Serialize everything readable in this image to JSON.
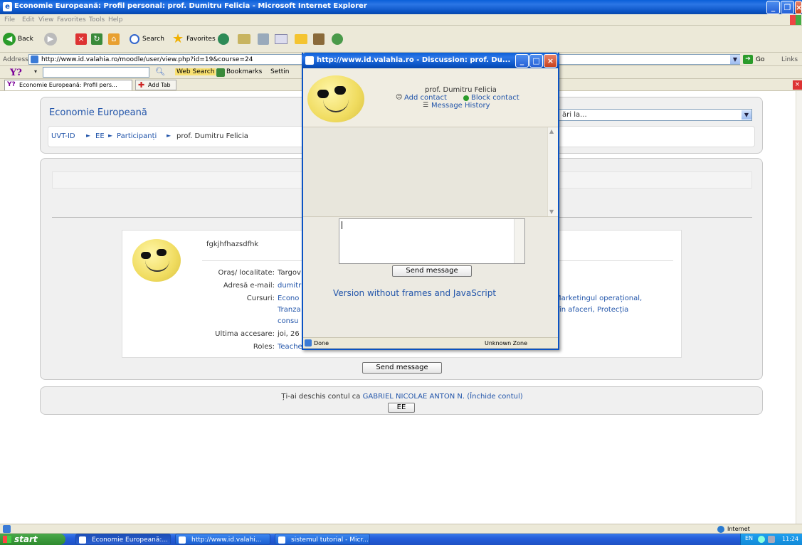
{
  "browser": {
    "title": "Economie Europeană: Profil personal: prof. Dumitru Felicia - Microsoft Internet Explorer",
    "menu": [
      "File",
      "Edit",
      "View",
      "Favorites",
      "Tools",
      "Help"
    ],
    "back_label": "Back",
    "search_label": "Search",
    "favorites_label": "Favorites",
    "address_label": "Address",
    "address_value": "http://www.id.valahia.ro/moodle/user/view.php?id=19&course=24",
    "go_label": "Go",
    "links_label": "Links",
    "yahoo_web_search": "Web Search",
    "yahoo_bookmarks": "Bookmarks",
    "yahoo_settings": "Settin",
    "tab_label": "Economie Europeană: Profil pers...",
    "add_tab_label": "Add Tab",
    "status_zone": "Internet"
  },
  "page": {
    "course_title": "Economie Europeană",
    "jump_select": "ări la...",
    "breadcrumb": [
      "UVT-ID",
      "EE",
      "Participanți",
      "prof. Dumitru Felicia"
    ],
    "breadcrumb_sep": "►",
    "profile": {
      "description": "fgkjhfhazsdfhk",
      "fields": [
        {
          "label": "Oraș/ localitate:",
          "value": "Targov"
        },
        {
          "label": "Adresă e-mail:",
          "value": "dumitr"
        },
        {
          "label": "Cursuri:",
          "value": "Econo"
        },
        {
          "label": "Ultima accesare:",
          "value": "joi, 26"
        },
        {
          "label": "Roles:",
          "value": "Teache"
        }
      ],
      "courses_line2": "Tranza",
      "courses_line3": "consu",
      "courses_right1": "Marketingul operațional,",
      "courses_right2": "în afaceri, Protecția"
    },
    "send_message_button": "Send message",
    "footer_text": "Ți-ai deschis contul ca",
    "footer_user": "GABRIEL NICOLAE ANTON N.",
    "footer_logout": "(Închide contul)",
    "footer_button": "EE"
  },
  "popup": {
    "title": "http://www.id.valahia.ro - Discussion: prof. Du...",
    "user_name": "prof. Dumitru Felicia",
    "add_contact": "Add contact",
    "block_contact": "Block contact",
    "message_history": "Message History",
    "send_button": "Send message",
    "no_frames_link": "Version without frames and JavaScript",
    "status_done": "Done",
    "status_zone": "Unknown Zone"
  },
  "taskbar": {
    "start_label": "start",
    "tasks": [
      "Economie Europeană:...",
      "http://www.id.valahi...",
      "sistemul tutorial - Micr..."
    ],
    "lang": "EN",
    "clock": "11:24"
  }
}
